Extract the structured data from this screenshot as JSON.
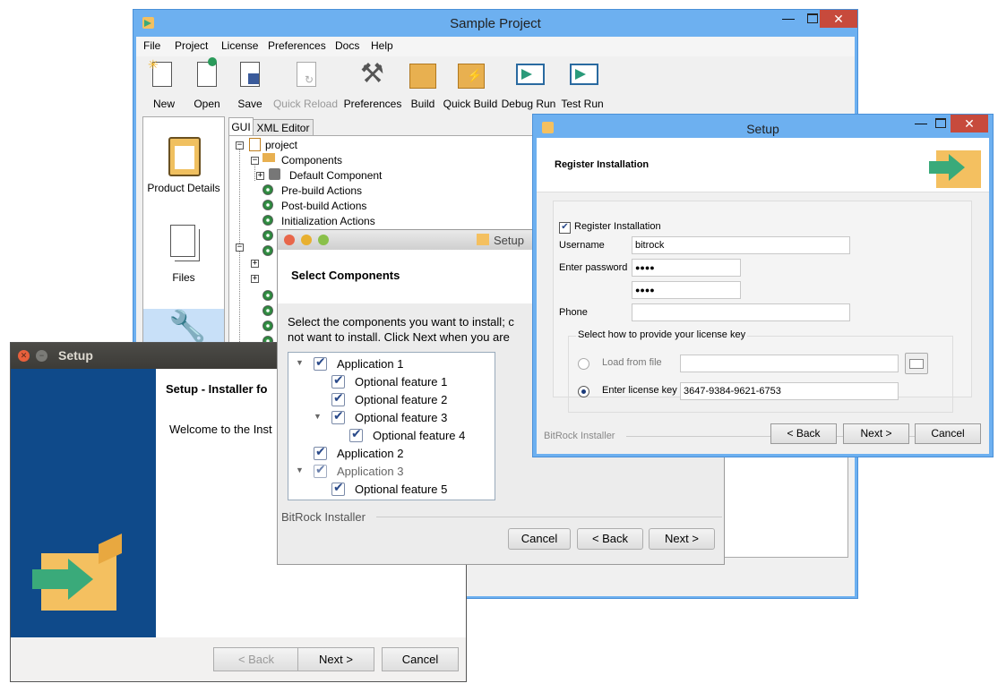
{
  "main_window": {
    "title": "Sample Project",
    "menu": [
      "File",
      "Project",
      "License",
      "Preferences",
      "Docs",
      "Help"
    ],
    "toolbar": [
      {
        "label": "New",
        "icon": "new-file-icon"
      },
      {
        "label": "Open",
        "icon": "open-file-icon"
      },
      {
        "label": "Save",
        "icon": "save-icon"
      },
      {
        "label": "Quick Reload",
        "icon": "reload-icon",
        "disabled": true
      },
      {
        "label": "Preferences",
        "icon": "tools-icon"
      },
      {
        "label": "Build",
        "icon": "box-icon"
      },
      {
        "label": "Quick Build",
        "icon": "quick-build-icon"
      },
      {
        "label": "Debug Run",
        "icon": "debug-run-icon"
      },
      {
        "label": "Test Run",
        "icon": "test-run-icon"
      }
    ],
    "sidebar": [
      {
        "label": "Product Details",
        "icon": "clipboard-icon"
      },
      {
        "label": "Files",
        "icon": "files-icon"
      }
    ],
    "tabs": [
      "GUI",
      "XML Editor"
    ],
    "tree": {
      "root": "project",
      "components": "Components",
      "default_component": "Default Component",
      "pre_build": "Pre-build Actions",
      "post_build": "Post-build Actions",
      "init": "Initialization Actions"
    }
  },
  "setup_register": {
    "title": "Setup",
    "header": "Register Installation",
    "checkbox_label": "Register Installation",
    "username_label": "Username",
    "username_value": "bitrock",
    "password_label": "Enter password",
    "password_value": "●●●●",
    "password_confirm": "●●●●",
    "phone_label": "Phone",
    "phone_value": "",
    "group_title": "Select how to provide your license key",
    "load_label": "Load from file",
    "enter_label": "Enter license key",
    "license_value": "3647-9384-9621-6753",
    "footer": "BitRock Installer",
    "back": "< Back",
    "next": "Next >",
    "cancel": "Cancel"
  },
  "setup_components": {
    "title": "Setup",
    "header": "Select Components",
    "instructions_line1": "Select the components you want to install; c",
    "instructions_line2": "not want to install. Click Next when you are",
    "items": [
      {
        "label": "Application 1",
        "level": 0,
        "expander": "▼",
        "enabled": true
      },
      {
        "label": "Optional feature 1",
        "level": 1,
        "expander": "",
        "enabled": true
      },
      {
        "label": "Optional feature 2",
        "level": 1,
        "expander": "",
        "enabled": true
      },
      {
        "label": "Optional feature 3",
        "level": 1,
        "expander": "▼",
        "enabled": true
      },
      {
        "label": "Optional feature 4",
        "level": 2,
        "expander": "",
        "enabled": true
      },
      {
        "label": "Application 2",
        "level": 0,
        "expander": "",
        "enabled": true
      },
      {
        "label": "Application 3",
        "level": 0,
        "expander": "▼",
        "enabled": false
      },
      {
        "label": "Optional feature 5",
        "level": 1,
        "expander": "",
        "enabled": true
      }
    ],
    "footer": "BitRock Installer",
    "cancel": "Cancel",
    "back": "< Back",
    "next": "Next >"
  },
  "setup_welcome": {
    "title": "Setup",
    "heading": "Setup - Installer fo",
    "welcome": "Welcome to the Inst",
    "back": "< Back",
    "next": "Next >",
    "cancel": "Cancel"
  },
  "colors": {
    "win8_frame": "#5aa0e8",
    "close_red": "#c74a3c",
    "welcome_sidebar": "#0f4a8a",
    "box_orange": "#f4c060",
    "arrow_green": "#3aaa7a"
  }
}
